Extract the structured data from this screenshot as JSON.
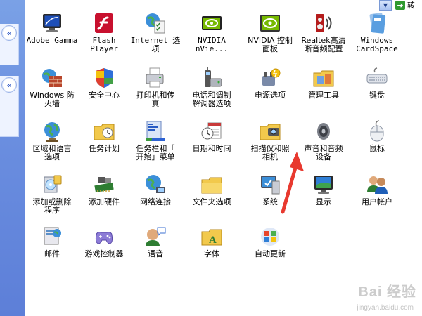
{
  "address_bar": {
    "go_label": "转"
  },
  "items": [
    {
      "label": "Adobe Gamma",
      "icon": "monitor-gamma-icon"
    },
    {
      "label": "Flash\nPlayer",
      "icon": "flash-icon"
    },
    {
      "label": "Internet 选\n项",
      "icon": "internet-options-icon"
    },
    {
      "label": "NVIDIA\nnVie...",
      "icon": "nvidia-icon"
    },
    {
      "label": "NVIDIA 控制\n面板",
      "icon": "nvidia-panel-icon"
    },
    {
      "label": "Realtek高清\n晰音频配置",
      "icon": "realtek-audio-icon"
    },
    {
      "label": "Windows\nCardSpace",
      "icon": "cardspace-icon"
    },
    {
      "label": "Windows 防\n火墙",
      "icon": "firewall-icon"
    },
    {
      "label": "安全中心",
      "icon": "security-shield-icon"
    },
    {
      "label": "打印机和传\n真",
      "icon": "printer-icon"
    },
    {
      "label": "电话和调制\n解调器选项",
      "icon": "phone-modem-icon"
    },
    {
      "label": "电源选项",
      "icon": "power-options-icon"
    },
    {
      "label": "管理工具",
      "icon": "admin-tools-icon"
    },
    {
      "label": "键盘",
      "icon": "keyboard-icon"
    },
    {
      "label": "区域和语言\n选项",
      "icon": "globe-icon"
    },
    {
      "label": "任务计划",
      "icon": "scheduled-tasks-icon"
    },
    {
      "label": "任务栏和「\n开始」菜单",
      "icon": "taskbar-icon"
    },
    {
      "label": "日期和时间",
      "icon": "date-time-icon"
    },
    {
      "label": "扫描仪和照\n相机",
      "icon": "scanner-camera-icon"
    },
    {
      "label": "声音和音频\n设备",
      "icon": "speaker-icon"
    },
    {
      "label": "鼠标",
      "icon": "mouse-icon"
    },
    {
      "label": "添加或删除\n程序",
      "icon": "add-remove-programs-icon"
    },
    {
      "label": "添加硬件",
      "icon": "add-hardware-icon"
    },
    {
      "label": "网络连接",
      "icon": "network-connections-icon"
    },
    {
      "label": "文件夹选项",
      "icon": "folder-options-icon"
    },
    {
      "label": "系统",
      "icon": "system-icon"
    },
    {
      "label": "显示",
      "icon": "display-icon"
    },
    {
      "label": "用户帐户",
      "icon": "user-accounts-icon"
    },
    {
      "label": "邮件",
      "icon": "mail-icon"
    },
    {
      "label": "游戏控制器",
      "icon": "game-controller-icon"
    },
    {
      "label": "语音",
      "icon": "speech-icon"
    },
    {
      "label": "字体",
      "icon": "fonts-folder-icon"
    },
    {
      "label": "自动更新",
      "icon": "windows-update-icon"
    }
  ],
  "watermark": {
    "text": "Bai 经验",
    "sub": "jingyan.baidu.com"
  },
  "colors": {
    "taskpane": "#6b8fe0",
    "annotation_arrow": "#e8392f"
  }
}
